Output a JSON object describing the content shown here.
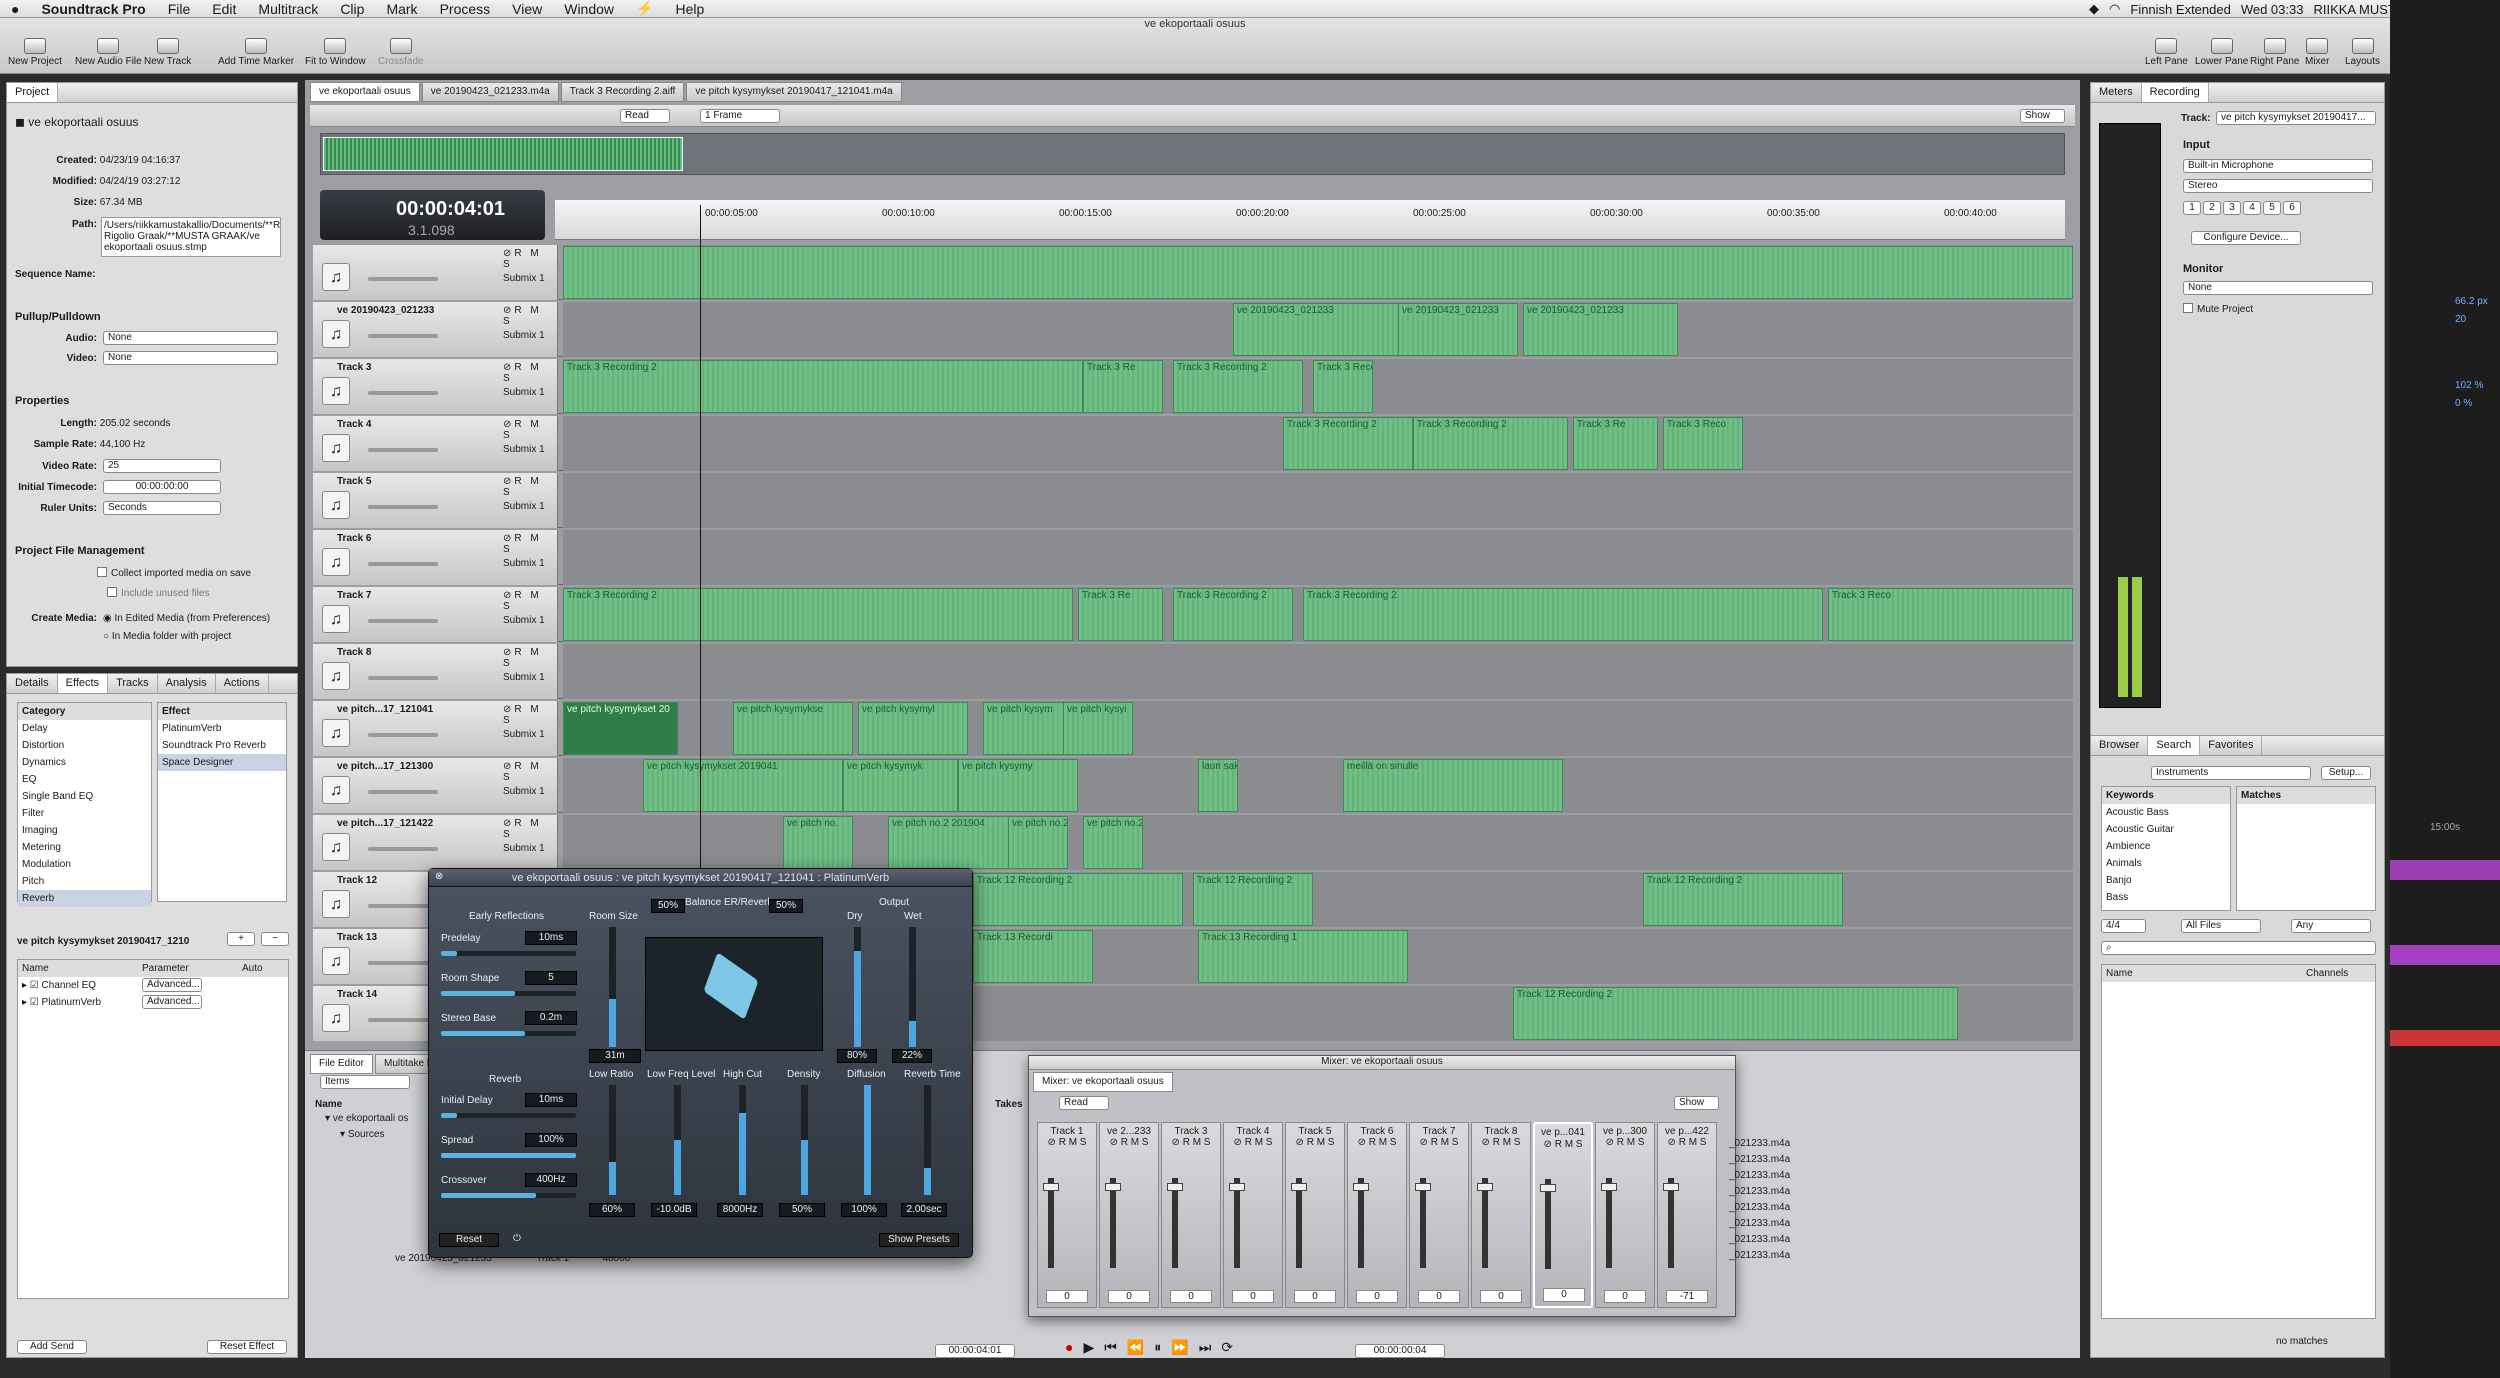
{
  "menubar": {
    "app": "Soundtrack Pro",
    "items": [
      "File",
      "Edit",
      "Multitrack",
      "Clip",
      "Mark",
      "Process",
      "View",
      "Window",
      "⚡",
      "Help"
    ],
    "input_source": "Finnish Extended",
    "clock": "Wed 03:33",
    "user": "RIIKKA MUSTAKALLIO"
  },
  "window": {
    "title": "ve ekoportaali osuus"
  },
  "toolbar": {
    "left": [
      "New Project",
      "New Audio File",
      "New Track",
      "Add Time Marker",
      "Fit to Window",
      "Crossfade"
    ],
    "right": [
      "Left Pane",
      "Lower Pane",
      "Right Pane",
      "Mixer",
      "Layouts"
    ]
  },
  "project": {
    "tab": "Project",
    "name": "ve ekoportaali osuus",
    "created_label": "Created:",
    "created": "04/23/19  04:16:37",
    "modified_label": "Modified:",
    "modified": "04/24/19  03:27:12",
    "size_label": "Size:",
    "size": "67.34 MB",
    "path_label": "Path:",
    "path": "/Users/riikkamustakallio/Documents/**RG Rigolio Graak/**MUSTA GRAAK/ve ekoportaali osuus.stmp",
    "seq_label": "Sequence Name:",
    "pullup": "Pullup/Pulldown",
    "audio_label": "Audio:",
    "audio": "None",
    "video_label": "Video:",
    "video": "None",
    "properties": "Properties",
    "length_label": "Length:",
    "length": "205.02 seconds",
    "rate_label": "Sample Rate:",
    "rate": "44,100 Hz",
    "vrate_label": "Video Rate:",
    "vrate": "25",
    "itc_label": "Initial Timecode:",
    "itc": "00:00:00:00",
    "ruler_label": "Ruler Units:",
    "ruler": "Seconds",
    "pfm": "Project File Management",
    "collect": "Collect imported media on save",
    "unused": "Include unused files",
    "create_label": "Create Media:",
    "opt1": "In Edited Media (from Preferences)",
    "opt2": "In Media folder with project"
  },
  "effects": {
    "tabs": [
      "Details",
      "Effects",
      "Tracks",
      "Analysis",
      "Actions"
    ],
    "cat_header": "Category",
    "categories": [
      "Delay",
      "Distortion",
      "Dynamics",
      "EQ",
      "Single Band EQ",
      "Filter",
      "Imaging",
      "Metering",
      "Modulation",
      "Pitch",
      "Reverb"
    ],
    "eff_header": "Effect",
    "effects": [
      "PlatinumVerb",
      "Soundtrack Pro Reverb",
      "Space Designer"
    ],
    "chain_title": "ve pitch kysymykset 20190417_1210",
    "col_name": "Name",
    "col_param": "Parameter",
    "col_auto": "Auto",
    "chain": [
      {
        "name": "Channel EQ",
        "btn": "Advanced..."
      },
      {
        "name": "PlatinumVerb",
        "btn": "Advanced..."
      }
    ],
    "add_send": "Add Send",
    "reset": "Reset Effect"
  },
  "timeline": {
    "tabs": [
      "ve ekoportaali osuus",
      "ve 20190423_021233.m4a",
      "Track 3 Recording 2.aiff",
      "ve pitch kysymykset 20190417_121041.m4a"
    ],
    "read": "Read",
    "frame": "1 Frame",
    "show": "Show",
    "timecode": "00:00:04:01",
    "beats": "3.1.098",
    "ruler": [
      "00:00:05:00",
      "00:00:10:00",
      "00:00:15:00",
      "00:00:20:00",
      "00:00:25:00",
      "00:00:30:00",
      "00:00:35:00",
      "00:00:40:00"
    ],
    "tracks": [
      {
        "name": "",
        "bus": "Submix 1",
        "clips": []
      },
      {
        "name": "ve 20190423_021233",
        "bus": "Submix 1",
        "clips": [
          "ve 20190423_021233",
          "ve 20190423_021233",
          "ve 20190423_021233"
        ]
      },
      {
        "name": "Track 3",
        "bus": "Submix 1",
        "clips": [
          "Track 3 Recording 2",
          "Track 3 Re",
          "Track 3 Recording 2",
          "Track 3 Recording 2"
        ]
      },
      {
        "name": "Track 4",
        "bus": "Submix 1",
        "clips": [
          "Track 3 Recording 2",
          "Track 3 Recording 2",
          "Track 3 Re",
          "Track 3 Reco"
        ]
      },
      {
        "name": "Track 5",
        "bus": "Submix 1",
        "clips": []
      },
      {
        "name": "Track 6",
        "bus": "Submix 1",
        "clips": []
      },
      {
        "name": "Track 7",
        "bus": "Submix 1",
        "clips": [
          "Track 3 Recording 2",
          "Track 3 Re",
          "Track 3 Recording 2",
          "Track 3 Recording 2",
          "Track 3 Reco"
        ]
      },
      {
        "name": "Track 8",
        "bus": "Submix 1",
        "clips": []
      },
      {
        "name": "ve pitch...17_121041",
        "bus": "Submix 1",
        "clips": [
          "ve pitch kysymykset 20",
          "ve pitch kysymykse",
          "ve pitch kysymyl",
          "ve pitch kysym",
          "ve pitch kysyi"
        ]
      },
      {
        "name": "ve pitch...17_121300",
        "bus": "Submix 1",
        "clips": [
          "ve pitch kysymykset 2019041",
          "ve pitch kysymyk",
          "ve pitch kysymy",
          "lauri saku 20",
          "meillä on sinulle"
        ]
      },
      {
        "name": "ve pitch...17_121422",
        "bus": "Submix 1",
        "clips": [
          "ve pitch no.",
          "ve pitch no.2 201904",
          "ve pitch no.2",
          "ve pitch no.2"
        ]
      },
      {
        "name": "Track 12",
        "bus": "Submix 1",
        "clips": [
          "Track 12 Recording 2",
          "Track 12 Recording 2",
          "Track 12 Recording 2"
        ]
      },
      {
        "name": "Track 13",
        "bus": "Submix 1",
        "clips": [
          "Track 13 Recordi",
          "Track 13 Recording 1"
        ]
      },
      {
        "name": "Track 14",
        "bus": "Submix 1",
        "clips": [
          "Track 12 Recording 2"
        ]
      }
    ]
  },
  "bottom": {
    "tabs": [
      "File Editor",
      "Multitake Ed"
    ],
    "items": "Items",
    "col_name": "Name",
    "col_takes": "Takes",
    "root": "ve ekoportaali os",
    "sources": "Sources",
    "rows": [
      "ve 20190423_021233",
      "Track 1",
      "48000"
    ],
    "timecode": "00:00:04:01",
    "timecode2": "00:00:00:04"
  },
  "plugin": {
    "title": "ve ekoportaali osuus : ve pitch kysymykset 20190417_121041 : PlatinumVerb",
    "early": "Early Reflections",
    "predelay": "Predelay",
    "predelay_val": "10ms",
    "room_shape": "Room Shape",
    "room_shape_val": "5",
    "stereo_base": "Stereo Base",
    "stereo_base_val": "0.2m",
    "room_size": "Room Size",
    "room_size_val": "31m",
    "balance": "Balance ER/Reverb",
    "bal_left": "50%",
    "bal_right": "50%",
    "output": "Output",
    "dry": "Dry",
    "wet": "Wet",
    "dry_val": "80%",
    "wet_val": "22%",
    "reverb": "Reverb",
    "init_delay": "Initial Delay",
    "init_delay_val": "10ms",
    "spread": "Spread",
    "spread_val": "100%",
    "crossover": "Crossover",
    "crossover_val": "400Hz",
    "low_ratio": "Low Ratio",
    "low_ratio_val": "60%",
    "low_freq": "Low Freq Level",
    "low_freq_val": "-10.0dB",
    "high_cut": "High Cut",
    "high_cut_val": "8000Hz",
    "density": "Density",
    "density_val": "50%",
    "diffusion": "Diffusion",
    "diffusion_val": "100%",
    "rev_time": "Reverb Time",
    "rev_time_val": "2.00sec",
    "reset": "Reset",
    "show_presets": "Show Presets"
  },
  "mixer": {
    "title": "Mixer: ve ekoportaali osuus",
    "tab": "Mixer: ve ekoportaali osuus",
    "read": "Read",
    "show": "Show",
    "strips": [
      "Track 1",
      "ve 2...233",
      "Track 3",
      "Track 4",
      "Track 5",
      "Track 6",
      "Track 7",
      "Track 8",
      "ve p...041",
      "ve p...300",
      "ve p...422"
    ],
    "values": [
      "0",
      "0",
      "0",
      "0",
      "0",
      "0",
      "0",
      "0",
      "0",
      "0",
      "-71"
    ],
    "file_rows": [
      "_021233.m4a",
      "_021233.m4a",
      "_021233.m4a",
      "_021233.m4a",
      "_021233.m4a",
      "_021233.m4a",
      "_021233.m4a",
      "_021233.m4a"
    ]
  },
  "right": {
    "tabs": [
      "Meters",
      "Recording"
    ],
    "track_label": "Track:",
    "track": "ve pitch kysymykset 20190417...",
    "input": "Input",
    "device": "Built-in Microphone",
    "mode": "Stereo",
    "channels": [
      "1",
      "2",
      "3",
      "4",
      "5",
      "6"
    ],
    "configure": "Configure Device...",
    "monitor": "Monitor",
    "monitor_val": "None",
    "mute": "Mute Project"
  },
  "browser": {
    "tabs": [
      "Browser",
      "Search",
      "Favorites"
    ],
    "category": "Instruments",
    "setup": "Setup...",
    "kw_header": "Keywords",
    "matches_header": "Matches",
    "keywords": [
      "Acoustic Bass",
      "Acoustic Guitar",
      "Ambience",
      "Animals",
      "Banjo",
      "Bass"
    ],
    "meter": "4/4",
    "files": "All Files",
    "any": "Any",
    "col_name": "Name",
    "col_channels": "Channels",
    "no_matches": "no matches"
  },
  "edge": {
    "zoom": "66.2 px",
    "size": "20",
    "pct1": "102 %",
    "pct2": "0 %",
    "time": "15:00s"
  }
}
